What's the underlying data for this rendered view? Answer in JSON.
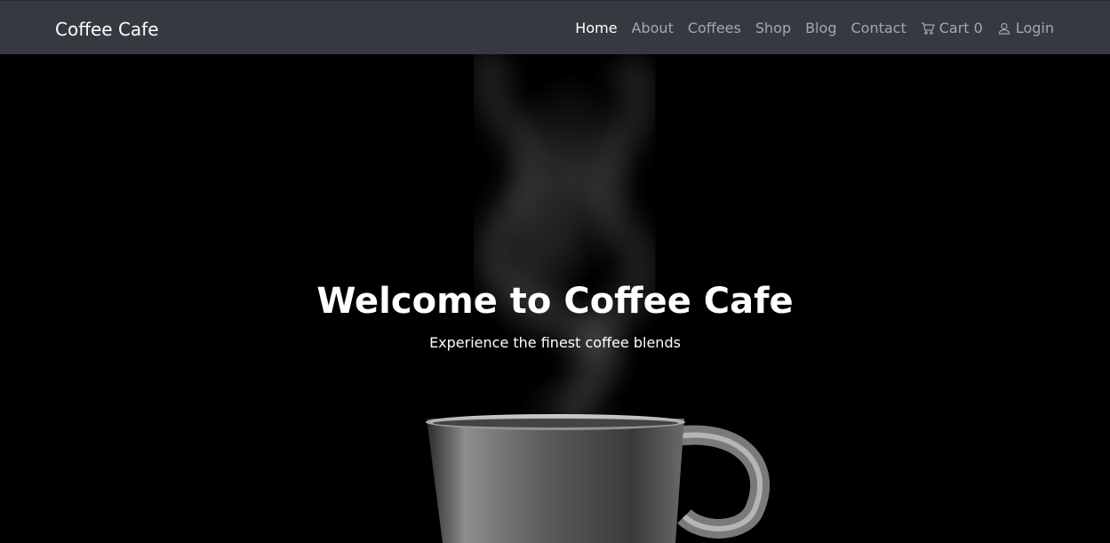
{
  "navbar": {
    "brand": "Coffee Cafe",
    "items": [
      {
        "label": "Home",
        "active": true
      },
      {
        "label": "About",
        "active": false
      },
      {
        "label": "Coffees",
        "active": false
      },
      {
        "label": "Shop",
        "active": false
      },
      {
        "label": "Blog",
        "active": false
      },
      {
        "label": "Contact",
        "active": false
      }
    ],
    "cart": {
      "label": "Cart 0",
      "icon": "cart-icon"
    },
    "login": {
      "label": "Login",
      "icon": "user-icon"
    },
    "colors": {
      "background": "#343a40",
      "active_link": "#ffffff",
      "link": "rgba(255,255,255,0.55)"
    }
  },
  "hero": {
    "title": "Welcome to Coffee Cafe",
    "subtitle": "Experience the finest coffee blends",
    "background": "#000000",
    "image": "steaming-coffee-cup"
  }
}
